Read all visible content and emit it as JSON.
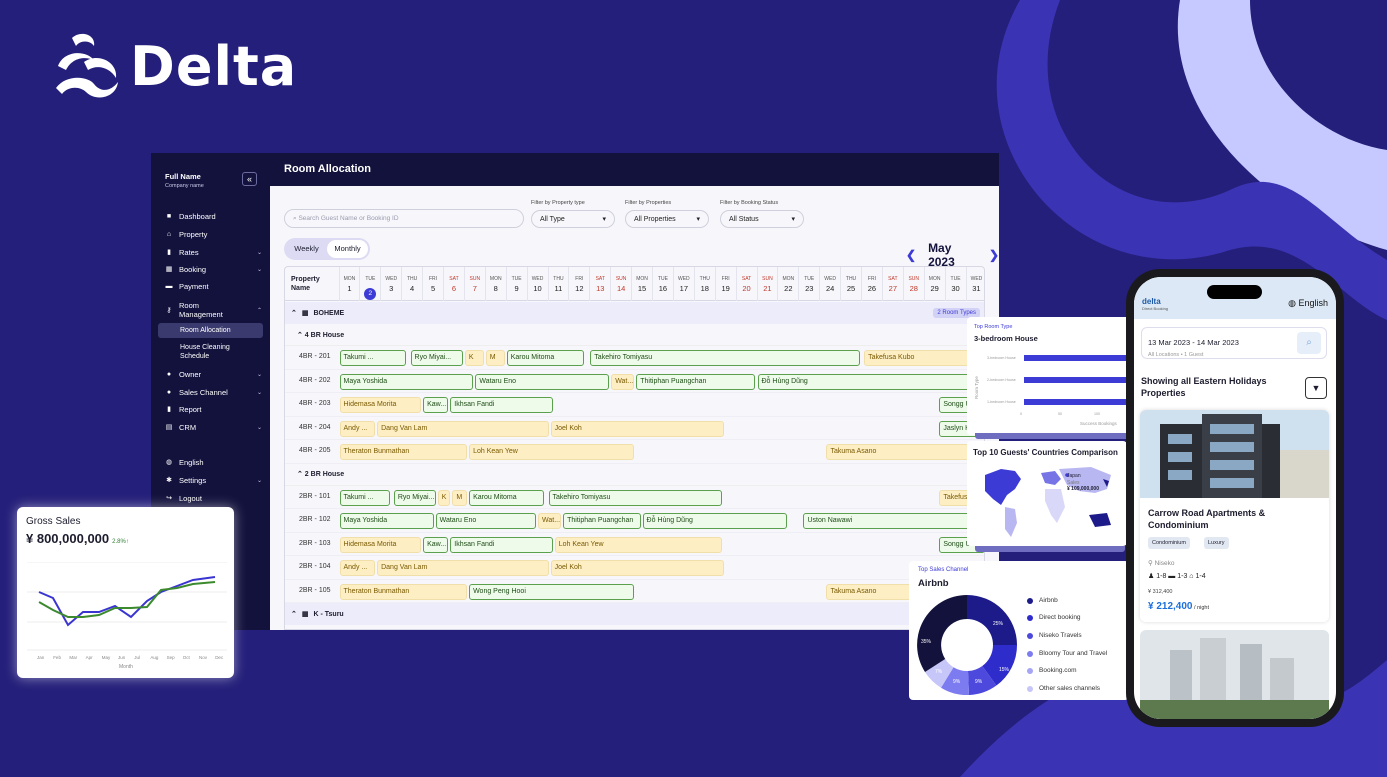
{
  "brand": {
    "name": "Delta"
  },
  "sidebar": {
    "full_name": "Full Name",
    "company": "Company name",
    "collapse": "«",
    "items": [
      {
        "label": "Dashboard"
      },
      {
        "label": "Property"
      },
      {
        "label": "Rates"
      },
      {
        "label": "Booking"
      },
      {
        "label": "Payment"
      },
      {
        "label": "Room\nManagement"
      },
      {
        "label": "Room Allocation"
      },
      {
        "label": "House Cleaning\nSchedule"
      },
      {
        "label": "Owner"
      },
      {
        "label": "Sales Channel"
      },
      {
        "label": "Report"
      },
      {
        "label": "CRM"
      },
      {
        "label": "English"
      },
      {
        "label": "Settings"
      },
      {
        "label": "Logout"
      }
    ]
  },
  "main": {
    "title": "Room Allocation",
    "search_placeholder": "Search Guest Name or Booking ID",
    "filters": [
      {
        "label": "Filter by Property type",
        "value": "All Type"
      },
      {
        "label": "Filter by Properties",
        "value": "All Properties"
      },
      {
        "label": "Filter by Booking Status",
        "value": "All Status"
      }
    ],
    "view_toggle": [
      "Weekly",
      "Monthly"
    ],
    "month": "May 2023",
    "prop_header": "Property\nName",
    "days": [
      {
        "d": "MON",
        "n": "1"
      },
      {
        "d": "TUE",
        "n": "2"
      },
      {
        "d": "WED",
        "n": "3"
      },
      {
        "d": "THU",
        "n": "4"
      },
      {
        "d": "FRI",
        "n": "5"
      },
      {
        "d": "SAT",
        "n": "6"
      },
      {
        "d": "SUN",
        "n": "7"
      },
      {
        "d": "MON",
        "n": "8"
      },
      {
        "d": "TUE",
        "n": "9"
      },
      {
        "d": "WED",
        "n": "10"
      },
      {
        "d": "THU",
        "n": "11"
      },
      {
        "d": "FRI",
        "n": "12"
      },
      {
        "d": "SAT",
        "n": "13"
      },
      {
        "d": "SUN",
        "n": "14"
      },
      {
        "d": "MON",
        "n": "15"
      },
      {
        "d": "TUE",
        "n": "16"
      },
      {
        "d": "WED",
        "n": "17"
      },
      {
        "d": "THU",
        "n": "18"
      },
      {
        "d": "FRI",
        "n": "19"
      },
      {
        "d": "SAT",
        "n": "20"
      },
      {
        "d": "SUN",
        "n": "21"
      },
      {
        "d": "MON",
        "n": "22"
      },
      {
        "d": "TUE",
        "n": "23"
      },
      {
        "d": "WED",
        "n": "24"
      },
      {
        "d": "THU",
        "n": "25"
      },
      {
        "d": "FRI",
        "n": "26"
      },
      {
        "d": "SAT",
        "n": "27"
      },
      {
        "d": "SUN",
        "n": "28"
      },
      {
        "d": "MON",
        "n": "29"
      },
      {
        "d": "TUE",
        "n": "30"
      },
      {
        "d": "WED",
        "n": "31"
      }
    ],
    "groups": [
      {
        "name": "BOHEME",
        "badge": "2 Room Types"
      },
      {
        "name": "K - Tsuru"
      }
    ],
    "subgroups": [
      "4 BR House",
      "2 BR House"
    ],
    "rooms": [
      {
        "label": "4BR - 201",
        "b": [
          {
            "t": "Takumi ...",
            "s": 1,
            "e": 4.3,
            "c": "g"
          },
          {
            "t": "Ryo Miyai...",
            "s": 4.4,
            "e": 7,
            "c": "g"
          },
          {
            "t": "K",
            "s": 7,
            "e": 8,
            "c": "y"
          },
          {
            "t": "M",
            "s": 8,
            "e": 9,
            "c": "y"
          },
          {
            "t": "Karou Mitoma",
            "s": 9,
            "e": 12.8,
            "c": "g"
          },
          {
            "t": "Takehiro Tomiyasu",
            "s": 13,
            "e": 26,
            "c": "g"
          },
          {
            "t": "Takefusa Kubo",
            "s": 26.1,
            "e": 32,
            "c": "y"
          }
        ]
      },
      {
        "label": "4BR - 202",
        "b": [
          {
            "t": "Maya Yoshida",
            "s": 1,
            "e": 7.5,
            "c": "g"
          },
          {
            "t": "Wataru Eno",
            "s": 7.5,
            "e": 14,
            "c": "g"
          },
          {
            "t": "Wat...",
            "s": 14,
            "e": 15.2,
            "c": "y"
          },
          {
            "t": "Thitiphan Puangchan",
            "s": 15.2,
            "e": 21,
            "c": "g"
          },
          {
            "t": "Đỗ Hùng Dũng",
            "s": 21,
            "e": 32,
            "c": "g"
          }
        ]
      },
      {
        "label": "4BR - 203",
        "b": [
          {
            "t": "Hidemasa Morita",
            "s": 1,
            "e": 5,
            "c": "y"
          },
          {
            "t": "Kaw...",
            "s": 5,
            "e": 6.3,
            "c": "g"
          },
          {
            "t": "Ikhsan Fandi",
            "s": 6.3,
            "e": 11.3,
            "c": "g"
          },
          {
            "t": "Songg Ul-Yo...",
            "s": 29.7,
            "e": 32,
            "c": "g"
          }
        ]
      },
      {
        "label": "4BR - 204",
        "b": [
          {
            "t": "Andy ...",
            "s": 1,
            "e": 2.8,
            "c": "y"
          },
          {
            "t": "Dang Van Lam",
            "s": 2.8,
            "e": 11.1,
            "c": "y"
          },
          {
            "t": "Joel Koh",
            "s": 11.1,
            "e": 19.5,
            "c": "y"
          },
          {
            "t": "Jaslyn Hooi",
            "s": 29.7,
            "e": 32,
            "c": "g"
          }
        ]
      },
      {
        "label": "4BR - 205",
        "b": [
          {
            "t": "Theraton Bunmathan",
            "s": 1,
            "e": 7.2,
            "c": "y"
          },
          {
            "t": "Loh Kean Yew",
            "s": 7.2,
            "e": 15.2,
            "c": "y"
          },
          {
            "t": "Takuma Asano",
            "s": 24.3,
            "e": 32,
            "c": "y"
          }
        ]
      },
      {
        "label": "2BR - 101",
        "b": [
          {
            "t": "Takumi ...",
            "s": 1,
            "e": 3.5,
            "c": "g"
          },
          {
            "t": "Ryo Miyai...",
            "s": 3.6,
            "e": 5.7,
            "c": "g"
          },
          {
            "t": "K",
            "s": 5.7,
            "e": 6.4,
            "c": "y"
          },
          {
            "t": "M",
            "s": 6.4,
            "e": 7.2,
            "c": "y"
          },
          {
            "t": "Karou Mitoma",
            "s": 7.2,
            "e": 10.9,
            "c": "g"
          },
          {
            "t": "Takehiro Tomiyasu",
            "s": 11,
            "e": 19.4,
            "c": "g"
          },
          {
            "t": "Takefusa Kub...",
            "s": 29.7,
            "e": 32,
            "c": "y"
          }
        ]
      },
      {
        "label": "2BR - 102",
        "b": [
          {
            "t": "Maya Yoshida",
            "s": 1,
            "e": 5.6,
            "c": "g"
          },
          {
            "t": "Wataru Eno",
            "s": 5.6,
            "e": 10.5,
            "c": "g"
          },
          {
            "t": "Wat...",
            "s": 10.5,
            "e": 11.7,
            "c": "y"
          },
          {
            "t": "Thitiphan Puangchan",
            "s": 11.7,
            "e": 15.5,
            "c": "g"
          },
          {
            "t": "Đỗ Hùng Dũng",
            "s": 15.5,
            "e": 22.5,
            "c": "g"
          },
          {
            "t": "Uston Nawawi",
            "s": 23.2,
            "e": 32,
            "c": "g"
          }
        ]
      },
      {
        "label": "2BR - 103",
        "b": [
          {
            "t": "Hidemasa Morita",
            "s": 1,
            "e": 5,
            "c": "y"
          },
          {
            "t": "Kaw...",
            "s": 5,
            "e": 6.3,
            "c": "g"
          },
          {
            "t": "Ikhsan Fandi",
            "s": 6.3,
            "e": 11.3,
            "c": "g"
          },
          {
            "t": "Loh Kean Yew",
            "s": 11.3,
            "e": 19.4,
            "c": "y"
          },
          {
            "t": "Songg Ul-Yo...",
            "s": 29.7,
            "e": 32,
            "c": "g"
          }
        ]
      },
      {
        "label": "2BR - 104",
        "b": [
          {
            "t": "Andy ...",
            "s": 1,
            "e": 2.8,
            "c": "y"
          },
          {
            "t": "Dang Van Lam",
            "s": 2.8,
            "e": 11.1,
            "c": "y"
          },
          {
            "t": "Joel Koh",
            "s": 11.1,
            "e": 19.5,
            "c": "y"
          }
        ]
      },
      {
        "label": "2BR - 105",
        "b": [
          {
            "t": "Theraton Bunmathan",
            "s": 1,
            "e": 7.2,
            "c": "y"
          },
          {
            "t": "Wong Peng Hooi",
            "s": 7.2,
            "e": 15.2,
            "c": "g"
          },
          {
            "t": "Takuma Asano",
            "s": 24.3,
            "e": 32,
            "c": "y"
          }
        ]
      }
    ]
  },
  "gross": {
    "title": "Gross Sales",
    "value": "¥ 800,000,000",
    "pct": "2.8%↑",
    "xlabel": "Month",
    "months": [
      "Jan",
      "Feb",
      "Mar",
      "Apr",
      "May",
      "Jun",
      "Jul",
      "Aug",
      "Sep",
      "Oct",
      "Nov",
      "Dec"
    ]
  },
  "room_type": {
    "subtitle": "Top Room Type",
    "title": "3-bedroom House",
    "ylabel": "Room Type",
    "xlabel": "Success Bookings",
    "cats": [
      "3-bedroom House",
      "2-bedroom House",
      "1-bedroom House"
    ],
    "ticks": [
      "0",
      "50",
      "100"
    ]
  },
  "countries": {
    "title": "Top 10 Guests' Countries Comparison",
    "tip_country": "Japan",
    "tip_label": "Sales",
    "tip_value": "¥ 109,000,000"
  },
  "channel": {
    "subtitle": "Top Sales Channel",
    "title": "Airbnb",
    "pcts": [
      "25%",
      "15%",
      "9%",
      "9%",
      "7%",
      "35%"
    ],
    "legend": [
      "Airbnb",
      "Direct booking",
      "Niseko Travels",
      "Bloomy Tour and Travel",
      "Booking.com",
      "Other sales channels"
    ]
  },
  "phone": {
    "logo": "delta",
    "logo_sub": "Direct Booking",
    "lang": "English",
    "dates": "13 Mar 2023 - 14 Mar 2023",
    "loc": "All Locations  •  1 Guest",
    "heading": "Showing all Eastern Holidays Properties",
    "card_name": "Carrow Road Apartments & Condominium",
    "tags": [
      "Condominium",
      "Luxury"
    ],
    "area": "Niseko",
    "stats": "1-8   ▬ 1-3   ⌂ 1-4",
    "old_price": "¥ 312,400",
    "price": "¥ 212,400",
    "per": " / night"
  },
  "colors": {
    "bg": "#241f7a",
    "navy": "#13123d",
    "accent": "#3d3bd6",
    "green": "#5aa04d",
    "amber": "#fdeec4"
  }
}
